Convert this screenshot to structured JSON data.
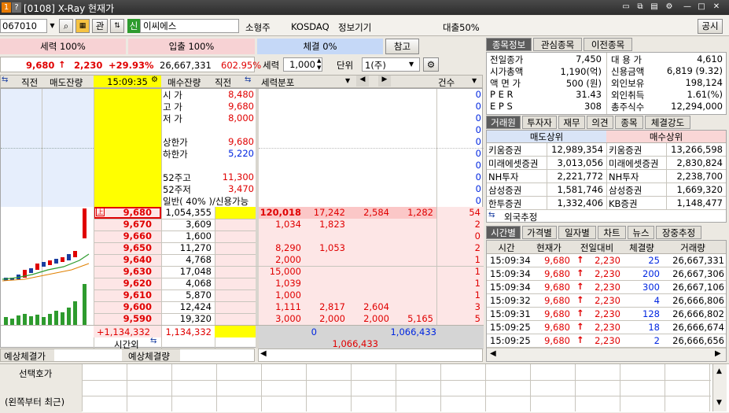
{
  "window": {
    "title": "[0108] X-Ray 현재가",
    "badge1": "1",
    "badge2": "?"
  },
  "toolbar": {
    "code": "067010",
    "btn_guan": "관",
    "shin": "신",
    "stock_name": "이씨에스",
    "category": "소형주",
    "market": "KOSDAQ",
    "info": "정보기기",
    "loan": "대출50%",
    "gongsi": "공시"
  },
  "ratios": {
    "sell": "세력 100%",
    "buy": "입출 100%",
    "trade": "체결 0%",
    "ref": "참고"
  },
  "price_line": {
    "price": "9,680",
    "arrow": "↑",
    "change": "2,230",
    "pct": "+29.93%",
    "volume": "26,667,331",
    "vol_pct": "602.95%"
  },
  "controls": {
    "label_force": "세력",
    "force_val": "1,000",
    "label_unit": "단위",
    "unit_val": "1(주)"
  },
  "orderbook": {
    "headers": {
      "direct1": "직전",
      "sell_rem": "매도잔량",
      "time": "15:09:35",
      "buy_rem": "매수잔량",
      "direct2": "직전",
      "force_dist": "세력분포",
      "count": "건수"
    },
    "info_rows": [
      {
        "label": "시 가",
        "value": "8,480"
      },
      {
        "label": "고 가",
        "value": "9,680"
      },
      {
        "label": "저 가",
        "value": "8,000"
      },
      {
        "label": "",
        "value": ""
      },
      {
        "label": "상한가",
        "value": "9,680"
      },
      {
        "label": "하한가",
        "value": "5,220"
      },
      {
        "label": "",
        "value": ""
      },
      {
        "label": "52주고",
        "value": "11,300"
      },
      {
        "label": "52주저",
        "value": "3,470"
      },
      {
        "label": "일반( 40% )/신용가능",
        "value": ""
      }
    ],
    "upper_counts": [
      "0",
      "0",
      "0",
      "0",
      "0",
      "0",
      "0",
      "0",
      "0",
      "0"
    ],
    "bids": [
      {
        "price": "9,680",
        "qty": "1,054,355",
        "f1": "120,018",
        "f2": "17,242",
        "f3": "2,584",
        "f4": "1,282",
        "cnt": "54"
      },
      {
        "price": "9,670",
        "qty": "3,609",
        "f1": "1,034",
        "f2": "1,823",
        "f3": "",
        "f4": "",
        "cnt": "2"
      },
      {
        "price": "9,660",
        "qty": "1,600",
        "f1": "",
        "f2": "",
        "f3": "",
        "f4": "",
        "cnt": "0"
      },
      {
        "price": "9,650",
        "qty": "11,270",
        "f1": "8,290",
        "f2": "1,053",
        "f3": "",
        "f4": "",
        "cnt": "2"
      },
      {
        "price": "9,640",
        "qty": "4,768",
        "f1": "2,000",
        "f2": "",
        "f3": "",
        "f4": "",
        "cnt": "1"
      },
      {
        "price": "9,630",
        "qty": "17,048",
        "f1": "15,000",
        "f2": "",
        "f3": "",
        "f4": "",
        "cnt": "1"
      },
      {
        "price": "9,620",
        "qty": "4,068",
        "f1": "1,039",
        "f2": "",
        "f3": "",
        "f4": "",
        "cnt": "1"
      },
      {
        "price": "9,610",
        "qty": "5,870",
        "f1": "1,000",
        "f2": "",
        "f3": "",
        "f4": "",
        "cnt": "1"
      },
      {
        "price": "9,600",
        "qty": "12,424",
        "f1": "1,111",
        "f2": "2,817",
        "f3": "2,604",
        "f4": "",
        "cnt": "3"
      },
      {
        "price": "9,590",
        "qty": "19,320",
        "f1": "3,000",
        "f2": "2,000",
        "f3": "2,000",
        "f4": "5,165",
        "cnt": "5"
      }
    ],
    "totals": {
      "diff": "+1,134,332",
      "total": "1,134,332",
      "after": "시간외",
      "z": "0",
      "t1": "1,066,433",
      "t2": "1,066,433"
    },
    "bottom": {
      "a": "예상체결가",
      "b": "예상체결량"
    }
  },
  "info_tabs": [
    "종목정보",
    "관심종목",
    "이전종목"
  ],
  "stock_info": [
    {
      "l1": "전일종가",
      "v1": "7,450",
      "l2": "대 용 가",
      "v2": "4,610"
    },
    {
      "l1": "시가총액",
      "v1": "1,190(억)",
      "l2": "신용금액",
      "v2": "6,819  (9.32)"
    },
    {
      "l1": "액 면 가",
      "v1": "500 (원)",
      "l2": "외인보유",
      "v2": "198,124"
    },
    {
      "l1": "P E R",
      "v1": "31.43",
      "l2": "외인취득",
      "v2": "1.61(%)"
    },
    {
      "l1": "E P S",
      "v1": "308",
      "l2": "총주식수",
      "v2": "12,294,000"
    }
  ],
  "broker_tabs": [
    "거래원",
    "투자자",
    "재무",
    "의견",
    "종목",
    "체결강도"
  ],
  "brokers": {
    "sell_hdr": "매도상위",
    "buy_hdr": "매수상위",
    "rows": [
      {
        "s": "키움증권",
        "sv": "12,989,354",
        "b": "키움증권",
        "bv": "13,266,598"
      },
      {
        "s": "미래에셋증권",
        "sv": "3,013,056",
        "b": "미래에셋증권",
        "bv": "2,830,824"
      },
      {
        "s": "NH투자",
        "sv": "2,221,772",
        "b": "NH투자",
        "bv": "2,238,700"
      },
      {
        "s": "삼성증권",
        "sv": "1,581,746",
        "b": "삼성증권",
        "bv": "1,669,320"
      },
      {
        "s": "한투증권",
        "sv": "1,332,406",
        "b": "KB증권",
        "bv": "1,148,477"
      }
    ],
    "foreign": "외국추정"
  },
  "time_tabs": [
    "시간별",
    "가격별",
    "일자별",
    "차트",
    "뉴스",
    "장중추정"
  ],
  "trades": {
    "headers": [
      "시간",
      "현재가",
      "전일대비",
      "체결량",
      "거래량"
    ],
    "rows": [
      {
        "t": "15:09:34",
        "p": "9,680",
        "c": "2,230",
        "q": "25",
        "v": "26,667,331"
      },
      {
        "t": "15:09:34",
        "p": "9,680",
        "c": "2,230",
        "q": "200",
        "v": "26,667,306"
      },
      {
        "t": "15:09:34",
        "p": "9,680",
        "c": "2,230",
        "q": "300",
        "v": "26,667,106"
      },
      {
        "t": "15:09:32",
        "p": "9,680",
        "c": "2,230",
        "q": "4",
        "v": "26,666,806"
      },
      {
        "t": "15:09:31",
        "p": "9,680",
        "c": "2,230",
        "q": "128",
        "v": "26,666,802"
      },
      {
        "t": "15:09:25",
        "p": "9,680",
        "c": "2,230",
        "q": "18",
        "v": "26,666,674"
      },
      {
        "t": "15:09:25",
        "p": "9,680",
        "c": "2,230",
        "q": "2",
        "v": "26,666,656"
      }
    ]
  },
  "footer": {
    "select": "선택호가",
    "recent": "(왼쪽부터 최근)"
  },
  "colors": {
    "red": "#e00000",
    "blue": "#0026e0",
    "yellow": "#ffff00",
    "pink": "#fde6e6",
    "lightblue": "#e6eefc"
  }
}
